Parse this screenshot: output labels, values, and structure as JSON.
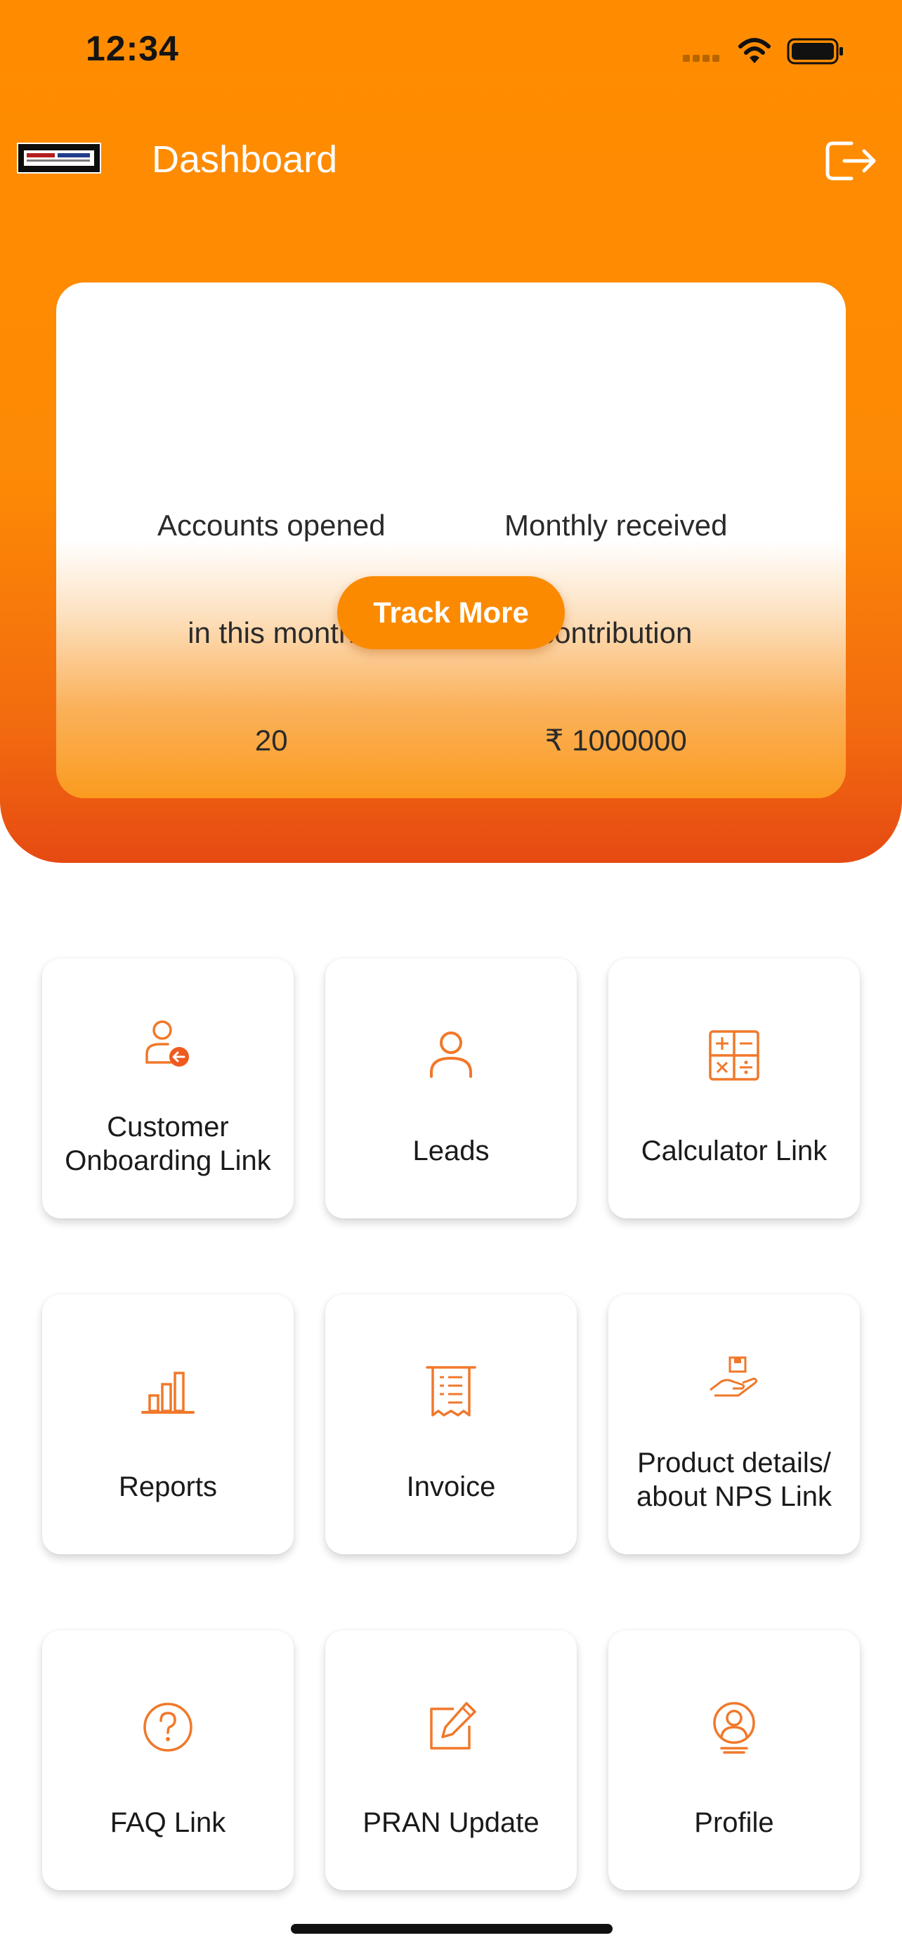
{
  "status_bar": {
    "time": "12:34"
  },
  "header": {
    "title": "Dashboard"
  },
  "summary": {
    "accounts": {
      "line1": "Accounts opened",
      "line2": "in this month",
      "value": "20"
    },
    "contribution": {
      "line1": "Monthly received",
      "line2": "contribution",
      "value": "₹ 1000000"
    },
    "track_more_label": "Track More"
  },
  "tiles": [
    {
      "line1": "Customer",
      "line2": "Onboarding Link",
      "icon": "customer-onboarding-icon"
    },
    {
      "line1": "Leads",
      "icon": "person-icon"
    },
    {
      "line1": "Calculator Link",
      "icon": "calculator-icon"
    },
    {
      "line1": "Reports",
      "icon": "bar-chart-icon"
    },
    {
      "line1": "Invoice",
      "icon": "invoice-icon"
    },
    {
      "line1": "Product details/",
      "line2": "about NPS Link",
      "icon": "hand-box-icon"
    },
    {
      "line1": "FAQ Link",
      "icon": "question-circle-icon"
    },
    {
      "line1": "PRAN Update",
      "icon": "edit-icon"
    },
    {
      "line1": "Profile",
      "icon": "profile-icon"
    }
  ],
  "colors": {
    "primary": "#fb8a00",
    "header_bottom": "#e64a12",
    "icon": "#f0782a"
  }
}
